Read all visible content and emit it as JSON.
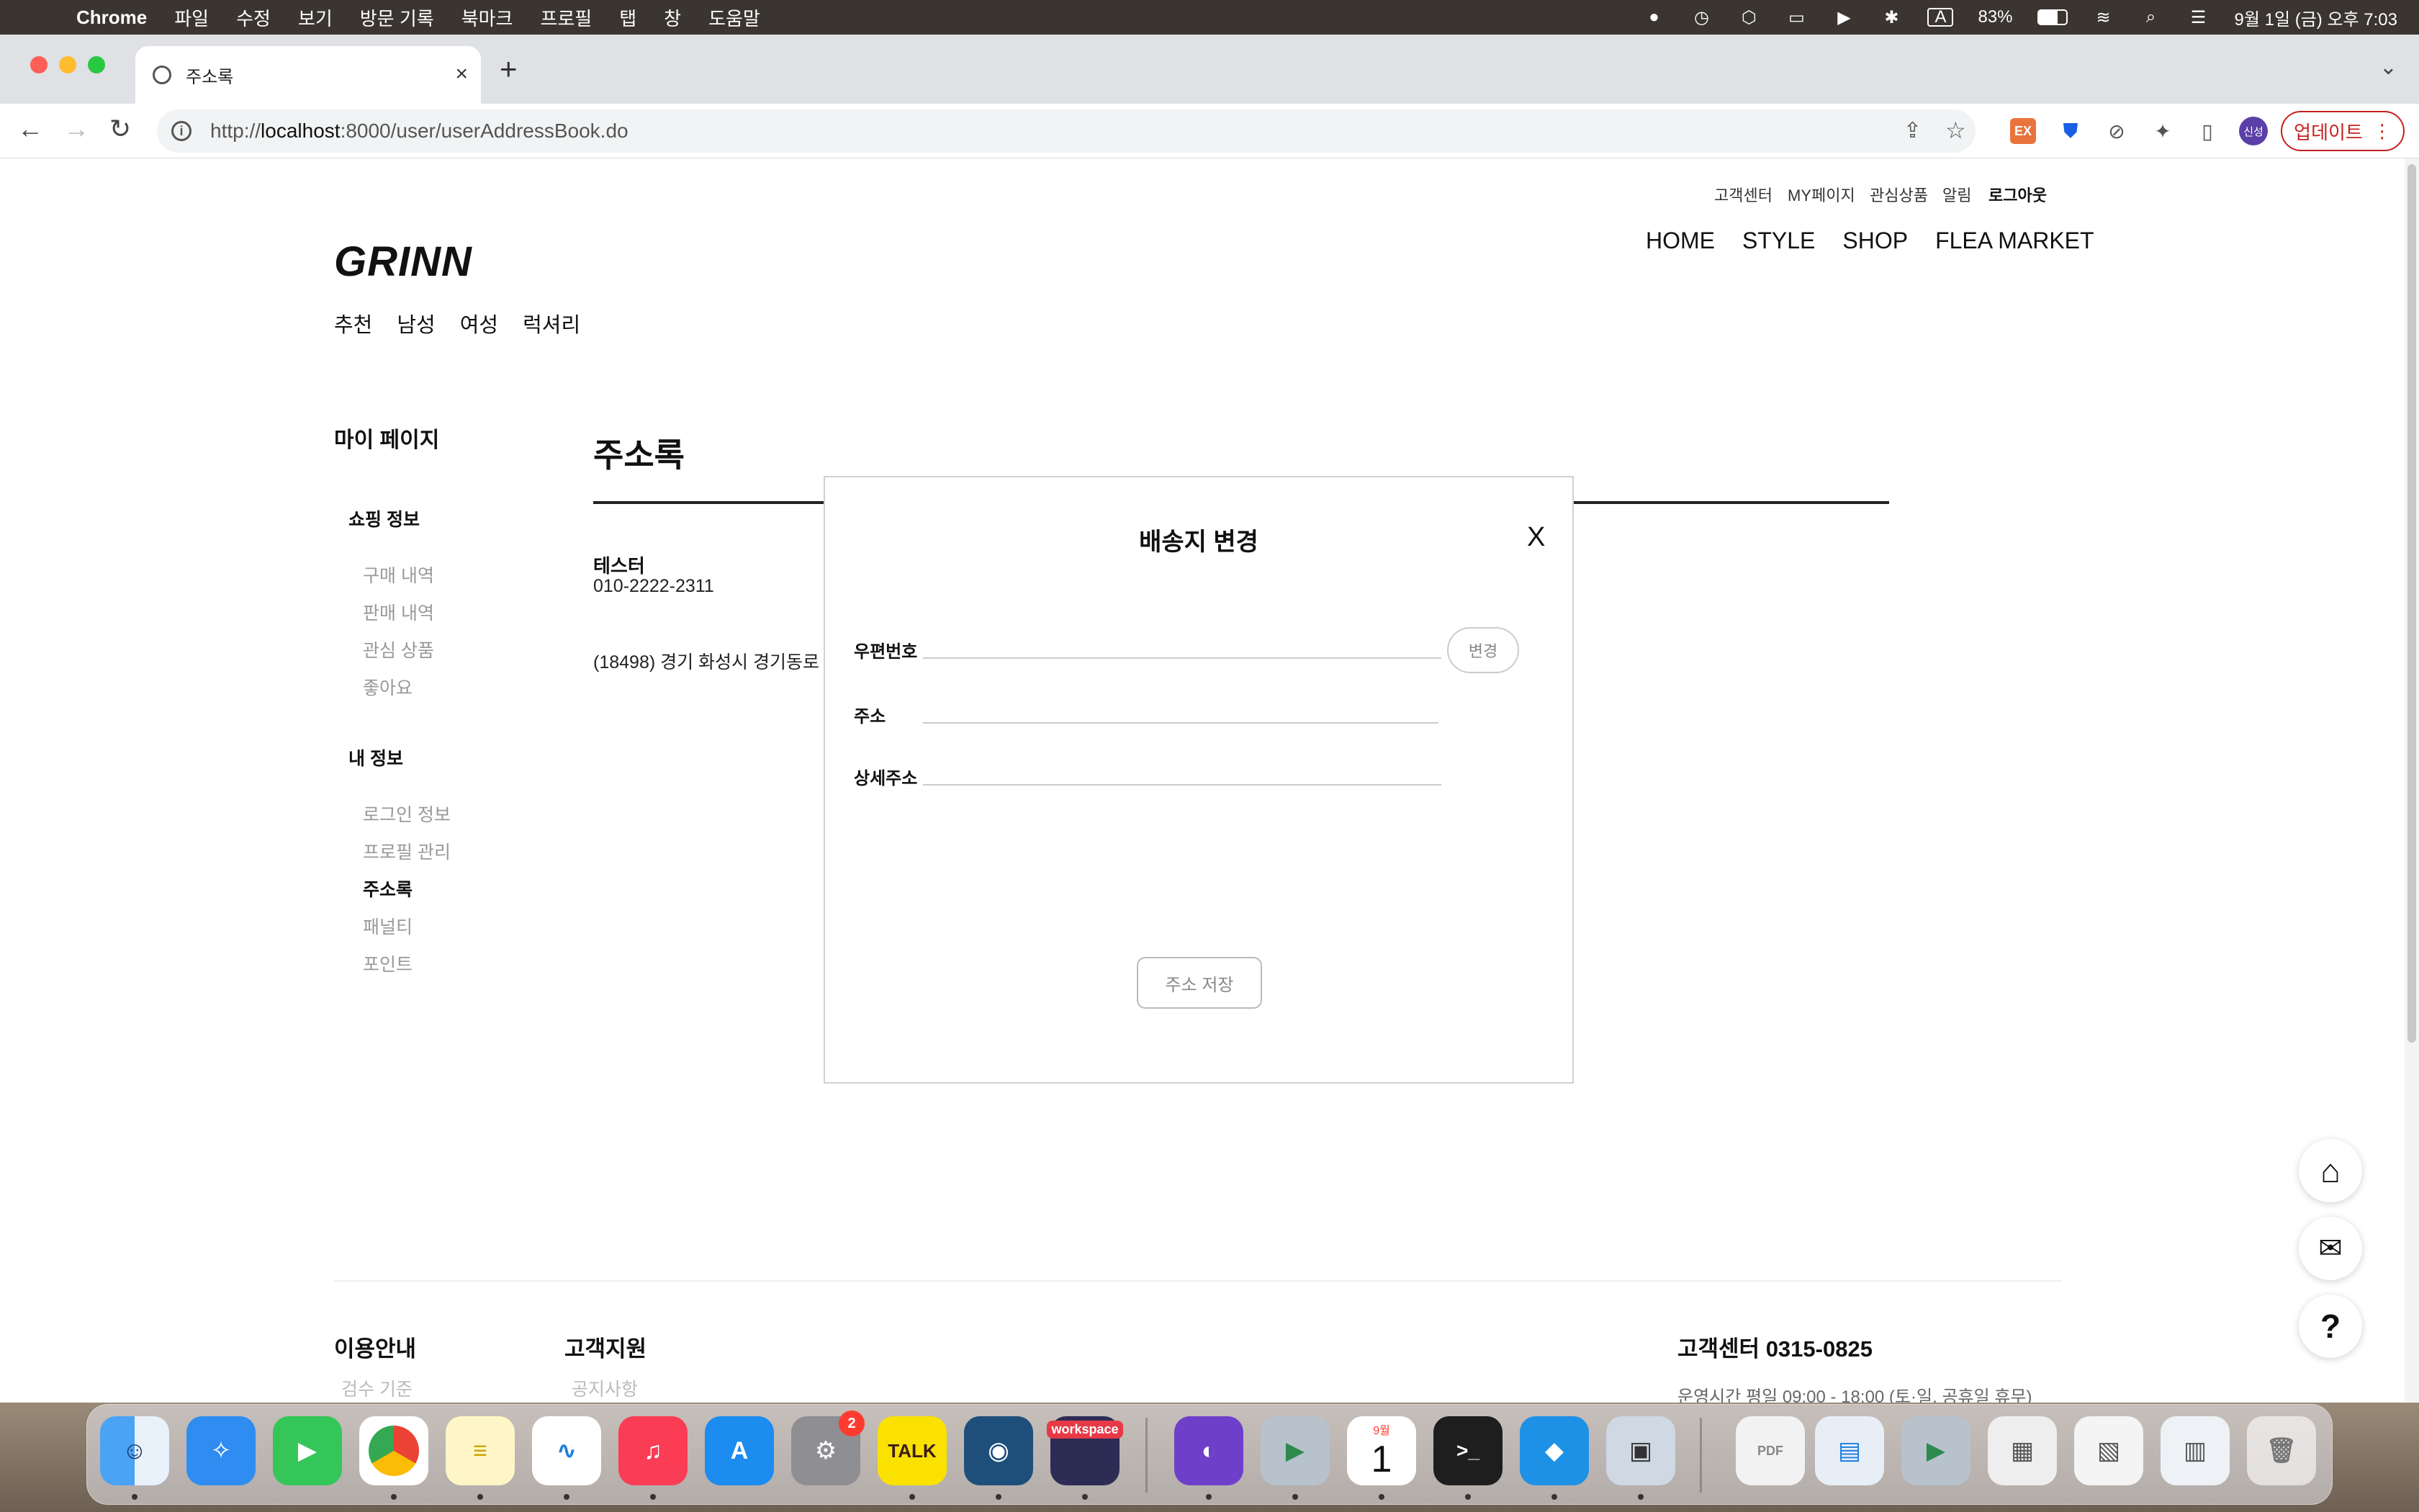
{
  "menubar": {
    "app_name": "Chrome",
    "items": [
      "파일",
      "수정",
      "보기",
      "방문 기록",
      "북마크",
      "프로필",
      "탭",
      "창",
      "도움말"
    ],
    "battery": "83%",
    "datetime": "9월 1일 (금) 오후 7:03"
  },
  "browser": {
    "tab_title": "주소록",
    "url_prefix": "http://",
    "url_host": "localhost",
    "url_rest": ":8000/user/userAddressBook.do",
    "update_label": "업데이트",
    "profile_initials": "신성",
    "ext_badge": "EX"
  },
  "site": {
    "logo": "GRINN",
    "util_links": [
      "고객센터",
      "MY페이지",
      "관심상품",
      "알림",
      "로그아웃"
    ],
    "gnb": [
      "HOME",
      "STYLE",
      "SHOP",
      "FLEA MARKET"
    ],
    "subnav": [
      "추천",
      "남성",
      "여성",
      "럭셔리"
    ]
  },
  "sidebar": {
    "title": "마이 페이지",
    "group1": "쇼핑 정보",
    "group1_items": [
      "구매 내역",
      "판매 내역",
      "관심 상품",
      "좋아요"
    ],
    "group2": "내 정보",
    "group2_items": [
      "로그인 정보",
      "프로필 관리",
      "주소록",
      "패널티",
      "포인트"
    ],
    "active": "주소록"
  },
  "content": {
    "title": "주소록",
    "name": "테스터",
    "phone": "010-2222-2311",
    "address": "(18498) 경기 화성시 경기동로"
  },
  "footer": {
    "col1_title": "이용안내",
    "col1_sub": "검수 기준",
    "col2_title": "고객지원",
    "col2_sub": "공지사항",
    "cs_title": "고객센터 0315-0825",
    "cs_hours": "운영시간 평일 09:00 - 18:00 (토·일, 공휴일 휴무)"
  },
  "modal": {
    "title": "배송지 변경",
    "close": "X",
    "zip_label": "우편번호",
    "zip_value": "",
    "change_label": "변경",
    "addr_label": "주소",
    "addr_value": "",
    "detail_label": "상세주소",
    "detail_value": "",
    "save_label": "주소 저장"
  },
  "dock": {
    "badge_settings": "2",
    "kakao_label": "TALK",
    "workspace_label": "workspace",
    "calendar_month": "9월",
    "calendar_day": "1"
  }
}
